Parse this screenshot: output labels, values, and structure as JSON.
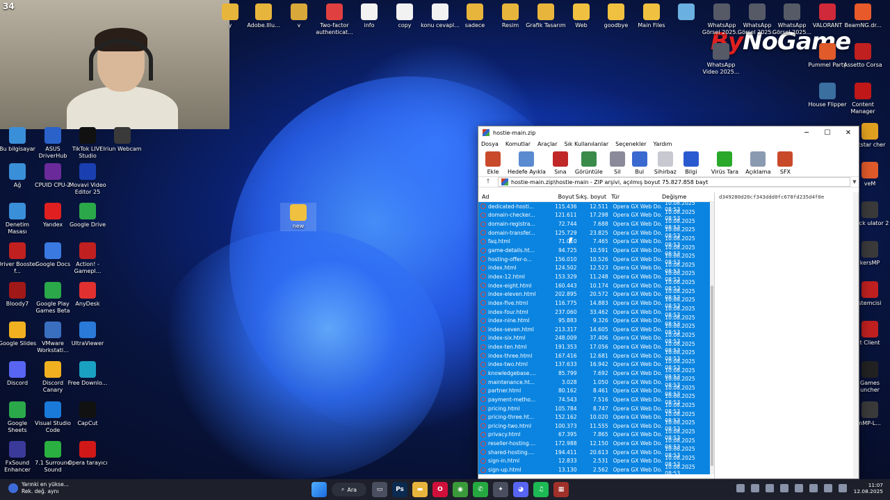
{
  "webcam": {
    "counter": "34"
  },
  "brand": {
    "by": "By",
    "name": "NoGame"
  },
  "desktop_icons_top": [
    {
      "label": "y",
      "color": "#e8b53c"
    },
    {
      "label": "Adobe.Illu...",
      "color": "#e8b53c"
    },
    {
      "label": "v",
      "color": "#d8a83a"
    },
    {
      "label": "Two-factor authenticat...",
      "color": "#e04040"
    },
    {
      "label": "info",
      "color": "#f2f2f2"
    },
    {
      "label": "copy",
      "color": "#f2f2f2"
    },
    {
      "label": "konu cevapl...",
      "color": "#f2f2f2"
    },
    {
      "label": "sadece",
      "color": "#e8b53c"
    },
    {
      "label": "Resim",
      "color": "#e8b53c"
    },
    {
      "label": "Grafik Tasarım",
      "color": "#e8b53c"
    },
    {
      "label": "Web",
      "color": "#f0c040"
    },
    {
      "label": "goodbye",
      "color": "#f0c040"
    },
    {
      "label": "Main Files",
      "color": "#f0c040"
    },
    {
      "label": "",
      "color": "#6ab0e0"
    },
    {
      "label": "WhatsApp Görsel 2025...",
      "color": "#555a66"
    },
    {
      "label": "WhatsApp Görsel 2025...",
      "color": "#555a66"
    },
    {
      "label": "WhatsApp Görsel 2025...",
      "color": "#555a66"
    },
    {
      "label": "VALORANT",
      "color": "#d0293a"
    },
    {
      "label": "BeamNG.dr...",
      "color": "#e85a2a"
    }
  ],
  "desktop_icons_left": [
    {
      "label": "Bu bilgisayar",
      "color": "#3a8fd9"
    },
    {
      "label": "ASUS DriverHub",
      "color": "#2a62c9"
    },
    {
      "label": "TikTok LIVE Studio",
      "color": "#111111"
    },
    {
      "label": "Iriun Webcam",
      "color": "#3a3a3a"
    },
    {
      "label": "Ağ",
      "color": "#3a8fd9"
    },
    {
      "label": "CPUID CPU-Z",
      "color": "#6a2a9a"
    },
    {
      "label": "Movavi Video Editor 25",
      "color": "#1a3fb0"
    },
    {
      "label": "Denetim Masası",
      "color": "#3a8fd9"
    },
    {
      "label": "Yandex",
      "color": "#e02020"
    },
    {
      "label": "Google Drive",
      "color": "#2aa84a"
    },
    {
      "label": "Driver Booster f...",
      "color": "#c02020"
    },
    {
      "label": "Google Docs",
      "color": "#3a7ae0"
    },
    {
      "label": "Action! - Gamepl...",
      "color": "#c02020"
    },
    {
      "label": "Bloody7",
      "color": "#a01818"
    },
    {
      "label": "Google Play Games Beta",
      "color": "#2aa84a"
    },
    {
      "label": "AnyDesk",
      "color": "#e03030"
    },
    {
      "label": "Google Slides",
      "color": "#f0b020"
    },
    {
      "label": "VMware Workstati...",
      "color": "#3a6fc0"
    },
    {
      "label": "UltraViewer",
      "color": "#2a7ad9"
    },
    {
      "label": "Discord",
      "color": "#5865f2"
    },
    {
      "label": "Discord Canary",
      "color": "#f0b020"
    },
    {
      "label": "Free Downlo...",
      "color": "#1aa0c0"
    },
    {
      "label": "Google Sheets",
      "color": "#2aa84a"
    },
    {
      "label": "Visual Studio Code",
      "color": "#1a7ad9"
    },
    {
      "label": "CapCut",
      "color": "#111111"
    },
    {
      "label": "FxSound Enhancer",
      "color": "#3a3a9a"
    },
    {
      "label": "7.1 Surround Sound",
      "color": "#2ab040"
    },
    {
      "label": "Opera tarayıcı",
      "color": "#d01818"
    }
  ],
  "desktop_icons_right": [
    {
      "label": "WhatsApp Video 2025...",
      "color": "#555a66"
    },
    {
      "label": "Pummel Party",
      "color": "#e05a2a"
    },
    {
      "label": "Assetto Corsa",
      "color": "#c02020"
    },
    {
      "label": "House Flipper",
      "color": "#3a6fa0"
    },
    {
      "label": "Content Manager",
      "color": "#c01818"
    },
    {
      "label": "ckstar cher",
      "color": "#e0a020"
    },
    {
      "label": "veM",
      "color": "#e05a2a"
    },
    {
      "label": "Truck ulator 2",
      "color": "#3a3a3a"
    },
    {
      "label": "kersMP",
      "color": "#3a3a3a"
    },
    {
      "label": "stemcisi",
      "color": "#c02020"
    },
    {
      "label": "t Client",
      "color": "#c02020"
    },
    {
      "label": "Games uncher",
      "color": "#222222"
    },
    {
      "label": "nMP-L...",
      "color": "#3a3a3a"
    }
  ],
  "new_folder": {
    "label": "new"
  },
  "window": {
    "title": "hostie-main.zip",
    "menu": [
      "Dosya",
      "Komutlar",
      "Araçlar",
      "Sık Kullanılanlar",
      "Seçenekler",
      "Yardım"
    ],
    "toolbar": [
      {
        "label": "Ekle",
        "color": "#c84a2a"
      },
      {
        "label": "Hedefe Ayıkla",
        "color": "#5a8ad0"
      },
      {
        "label": "Sına",
        "color": "#c02828"
      },
      {
        "label": "Görüntüle",
        "color": "#3a8a4a"
      },
      {
        "label": "Sil",
        "color": "#8a8a9a"
      },
      {
        "label": "Bul",
        "color": "#3a6ad0"
      },
      {
        "label": "Sihirbaz",
        "color": "#c8c8d0"
      },
      {
        "label": "Bilgi",
        "color": "#2a5ad0"
      },
      {
        "label": "Virüs Tara",
        "color": "#2aa82a"
      },
      {
        "label": "Açıklama",
        "color": "#8a9ab0"
      },
      {
        "label": "SFX",
        "color": "#c84a2a"
      }
    ],
    "address": "hostie-main.zip\\hostie-main - ZIP arşivi, açılmış boyut 75.827.858 bayt",
    "columns": {
      "name": "Ad",
      "size": "Boyut",
      "packed": "Sıkş. boyut",
      "type": "Tür",
      "modified": "Değişme"
    },
    "info_text": "d349280d20cf343ddd0fc678fd235d4f0e",
    "files": [
      {
        "name": "dedicated-hosti...",
        "size": "115.436",
        "packed": "12.511",
        "type": "Opera GX Web Do...",
        "modified": "10.08.2025 08:53"
      },
      {
        "name": "domain-checker...",
        "size": "121.611",
        "packed": "17.298",
        "type": "Opera GX Web Do...",
        "modified": "10.08.2025 08:53"
      },
      {
        "name": "domain-registra...",
        "size": "72.744",
        "packed": "7.688",
        "type": "Opera GX Web Do...",
        "modified": "10.08.2025 08:53"
      },
      {
        "name": "domain-transfer...",
        "size": "125.729",
        "packed": "23.825",
        "type": "Opera GX Web Do...",
        "modified": "10.08.2025 08:53"
      },
      {
        "name": "faq.html",
        "size": "71.010",
        "packed": "7.465",
        "type": "Opera GX Web Do...",
        "modified": "10.08.2025 08:53"
      },
      {
        "name": "game-details.ht...",
        "size": "94.725",
        "packed": "10.591",
        "type": "Opera GX Web Do...",
        "modified": "10.08.2025 08:53"
      },
      {
        "name": "hosting-offer-o...",
        "size": "156.010",
        "packed": "10.526",
        "type": "Opera GX Web Do...",
        "modified": "10.08.2025 08:53"
      },
      {
        "name": "index.html",
        "size": "124.502",
        "packed": "12.523",
        "type": "Opera GX Web Do...",
        "modified": "10.08.2025 08:53"
      },
      {
        "name": "index-12.html",
        "size": "153.329",
        "packed": "11.248",
        "type": "Opera GX Web Do...",
        "modified": "10.08.2025 08:53"
      },
      {
        "name": "index-eight.html",
        "size": "160.443",
        "packed": "10.174",
        "type": "Opera GX Web Do...",
        "modified": "10.08.2025 08:53"
      },
      {
        "name": "index-eleven.html",
        "size": "202.895",
        "packed": "20.572",
        "type": "Opera GX Web Do...",
        "modified": "10.08.2025 08:53"
      },
      {
        "name": "index-five.html",
        "size": "116.775",
        "packed": "14.883",
        "type": "Opera GX Web Do...",
        "modified": "10.08.2025 08:53"
      },
      {
        "name": "index-four.html",
        "size": "237.060",
        "packed": "33.462",
        "type": "Opera GX Web Do...",
        "modified": "10.08.2025 08:53"
      },
      {
        "name": "index-nine.html",
        "size": "95.883",
        "packed": "9.326",
        "type": "Opera GX Web Do...",
        "modified": "10.08.2025 08:53"
      },
      {
        "name": "index-seven.html",
        "size": "213.317",
        "packed": "14.605",
        "type": "Opera GX Web Do...",
        "modified": "10.08.2025 08:53"
      },
      {
        "name": "index-six.html",
        "size": "248.009",
        "packed": "37.406",
        "type": "Opera GX Web Do...",
        "modified": "10.08.2025 08:53"
      },
      {
        "name": "index-ten.html",
        "size": "191.353",
        "packed": "17.056",
        "type": "Opera GX Web Do...",
        "modified": "10.08.2025 08:53"
      },
      {
        "name": "index-three.html",
        "size": "167.416",
        "packed": "12.681",
        "type": "Opera GX Web Do...",
        "modified": "10.08.2025 08:53"
      },
      {
        "name": "index-two.html",
        "size": "137.633",
        "packed": "16.942",
        "type": "Opera GX Web Do...",
        "modified": "10.08.2025 08:53"
      },
      {
        "name": "knowledgebase....",
        "size": "85.799",
        "packed": "7.692",
        "type": "Opera GX Web Do...",
        "modified": "10.08.2025 08:53"
      },
      {
        "name": "maintenance.ht...",
        "size": "3.028",
        "packed": "1.050",
        "type": "Opera GX Web Do...",
        "modified": "10.08.2025 08:53"
      },
      {
        "name": "partner.html",
        "size": "80.162",
        "packed": "8.461",
        "type": "Opera GX Web Do...",
        "modified": "10.08.2025 08:53"
      },
      {
        "name": "payment-metho...",
        "size": "74.543",
        "packed": "7.516",
        "type": "Opera GX Web Do...",
        "modified": "10.08.2025 08:53"
      },
      {
        "name": "pricing.html",
        "size": "105.784",
        "packed": "8.747",
        "type": "Opera GX Web Do...",
        "modified": "10.08.2025 08:53"
      },
      {
        "name": "pricing-three.ht...",
        "size": "152.162",
        "packed": "10.020",
        "type": "Opera GX Web Do...",
        "modified": "10.08.2025 08:53"
      },
      {
        "name": "pricing-two.html",
        "size": "100.373",
        "packed": "11.555",
        "type": "Opera GX Web Do...",
        "modified": "10.08.2025 08:53"
      },
      {
        "name": "privacy.html",
        "size": "67.395",
        "packed": "7.865",
        "type": "Opera GX Web Do...",
        "modified": "10.08.2025 08:53"
      },
      {
        "name": "reseller-hosting....",
        "size": "172.988",
        "packed": "12.150",
        "type": "Opera GX Web Do...",
        "modified": "10.08.2025 08:53"
      },
      {
        "name": "shared-hosting....",
        "size": "194.411",
        "packed": "20.613",
        "type": "Opera GX Web Do...",
        "modified": "10.08.2025 08:53"
      },
      {
        "name": "sign-in.html",
        "size": "12.833",
        "packed": "2.531",
        "type": "Opera GX Web Do...",
        "modified": "10.08.2025 08:53"
      },
      {
        "name": "sign-up.html",
        "size": "13.130",
        "packed": "2.562",
        "type": "Opera GX Web Do...",
        "modified": "10.08.2025 08:53"
      }
    ]
  },
  "taskbar": {
    "weather_line1": "Yarınki en yükse...",
    "weather_line2": "Rek. değ. aynı",
    "search_label": "Ara",
    "apps": [
      {
        "name": "explorer",
        "glyph": "▭",
        "color": "#4a4f60"
      },
      {
        "name": "photoshop",
        "glyph": "Ps",
        "color": "#0a2a50"
      },
      {
        "name": "folder",
        "glyph": "▬",
        "color": "#e8b53c"
      },
      {
        "name": "opera-gx",
        "glyph": "O",
        "color": "#d0103a"
      },
      {
        "name": "chrome",
        "glyph": "◉",
        "color": "#3a9a3a"
      },
      {
        "name": "whatsapp",
        "glyph": "✆",
        "color": "#25a840"
      },
      {
        "name": "settings",
        "glyph": "✦",
        "color": "#4a4f60"
      },
      {
        "name": "discord",
        "glyph": "◕",
        "color": "#5865f2"
      },
      {
        "name": "spotify",
        "glyph": "♫",
        "color": "#1db954"
      },
      {
        "name": "winrar",
        "glyph": "▦",
        "color": "#a0302a"
      }
    ],
    "time": "11:07",
    "date": "12.08.2025"
  }
}
